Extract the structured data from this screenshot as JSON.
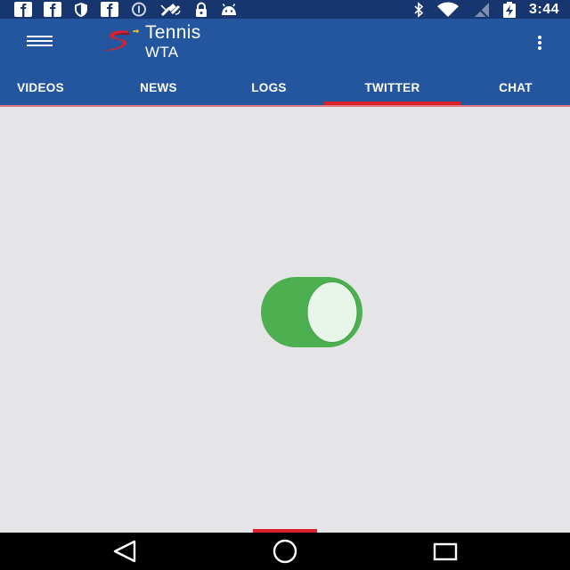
{
  "status_bar": {
    "time": "3:44",
    "left_icons": [
      "facebook-icon",
      "facebook-icon",
      "shield-icon",
      "facebook-icon",
      "data-saver-icon",
      "satellite-icon",
      "lock-icon",
      "android-icon"
    ],
    "right_icons": [
      "bluetooth-icon",
      "wifi-icon",
      "signal-off-icon",
      "battery-charging-icon"
    ]
  },
  "app_bar": {
    "title": "Tennis",
    "subtitle": "WTA",
    "colors": {
      "app_bar": "#2456a0",
      "status_bar": "#17366f",
      "accent": "#d91f27"
    }
  },
  "tabs": [
    {
      "label": "VIDEOS"
    },
    {
      "label": "NEWS"
    },
    {
      "label": "LOGS"
    },
    {
      "label": "TWITTER",
      "selected": true
    },
    {
      "label": "CHAT"
    }
  ],
  "content": {
    "loader_icon": "loading-spinner-icon",
    "loader_color": "#4caf50"
  },
  "nav_bar": {
    "buttons": [
      "back-icon",
      "home-icon",
      "recent-apps-icon"
    ]
  }
}
